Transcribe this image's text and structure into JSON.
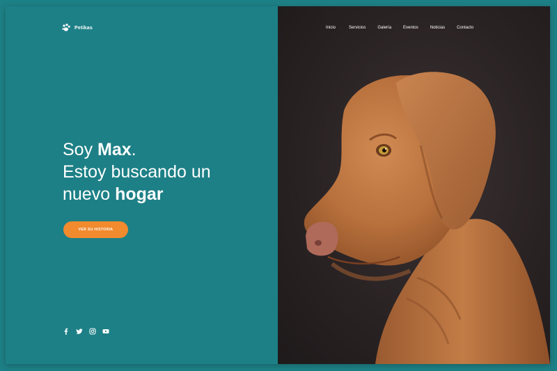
{
  "brand": {
    "name": "Petikas"
  },
  "nav": {
    "items": [
      {
        "label": "Inicio"
      },
      {
        "label": "Servicios"
      },
      {
        "label": "Galería"
      },
      {
        "label": "Eventos"
      },
      {
        "label": "Noticias"
      },
      {
        "label": "Contacto"
      }
    ]
  },
  "hero": {
    "line1_prefix": "Soy ",
    "line1_bold": "Max",
    "line1_suffix": ".",
    "line2": "Estoy buscando un",
    "line3_prefix": "nuevo ",
    "line3_bold": "hogar"
  },
  "cta": {
    "label": "Ver su historia"
  },
  "social": {
    "icons": [
      "facebook-icon",
      "twitter-icon",
      "instagram-icon",
      "youtube-icon"
    ]
  },
  "colors": {
    "teal": "#1d8086",
    "accent": "#f28a2e",
    "dark_bg": "#2a2324"
  }
}
